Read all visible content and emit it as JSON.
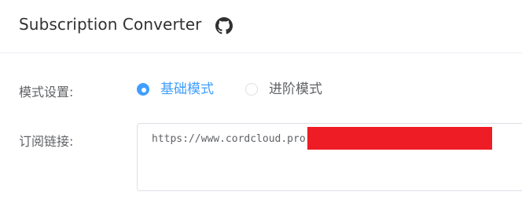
{
  "header": {
    "title": "Subscription Converter",
    "github_icon": "github-icon"
  },
  "form": {
    "mode": {
      "label": "模式设置:",
      "options": [
        {
          "label": "基础模式",
          "selected": true
        },
        {
          "label": "进阶模式",
          "selected": false
        }
      ]
    },
    "subscription": {
      "label": "订阅链接:",
      "value": "https://www.cordcloud.pro"
    }
  },
  "colors": {
    "accent": "#409eff",
    "redaction": "#ee1c25",
    "border": "#dcdfe6",
    "label_text": "#606266"
  }
}
